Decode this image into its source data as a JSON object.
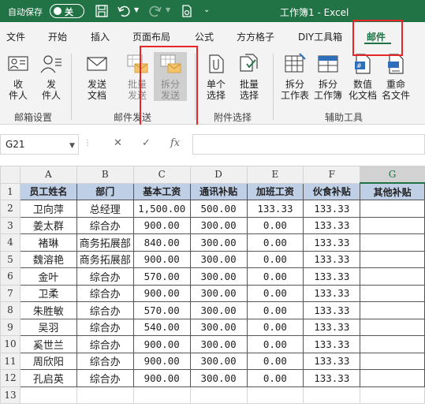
{
  "titlebar": {
    "autosave_label": "自动保存",
    "autosave_state": "关",
    "doc_title": "工作簿1  -  Excel",
    "icons": [
      "save-icon",
      "undo-icon",
      "redo-icon",
      "touch-mode-icon",
      "customize-qat-icon"
    ]
  },
  "tabs": [
    "文件",
    "开始",
    "插入",
    "页面布局",
    "公式",
    "方方格子",
    "DIY工具箱",
    "邮件"
  ],
  "active_tab": "邮件",
  "ribbon": {
    "buttons": {
      "recipient": "收\n件人",
      "sender": "发\n件人",
      "send_doc": "发送\n文档",
      "batch_send": "批量\n发送",
      "split_send": "拆分\n发送",
      "single_select": "单个\n选择",
      "batch_select": "批量\n选择",
      "split_sheet": "拆分\n工作表",
      "split_book": "拆分\n工作簿",
      "num_to_text": "数值\n化文档",
      "rename_file": "重命\n名文件"
    },
    "groups": {
      "mailbox_settings": "邮箱设置",
      "mail_send": "邮件发送",
      "attachment_select": "附件选择",
      "aux_tools": "辅助工具"
    }
  },
  "formula_bar": {
    "name_box": "G21",
    "cancel_symbol": "✕",
    "enter_symbol": "✓",
    "fx_symbol": "fx",
    "formula": ""
  },
  "sheet": {
    "columns": [
      "A",
      "B",
      "C",
      "D",
      "E",
      "F",
      "G"
    ],
    "selected_column": "G",
    "row_numbers": [
      "1",
      "2",
      "3",
      "4",
      "5",
      "6",
      "7",
      "8",
      "9",
      "10",
      "11",
      "12",
      "13"
    ],
    "headers": [
      "员工姓名",
      "部门",
      "基本工资",
      "通讯补贴",
      "加班工资",
      "伙食补贴",
      "其他补贴"
    ],
    "rows": [
      [
        "卫向萍",
        "总经理",
        "1,500.00",
        "500.00",
        "133.33",
        "133.33",
        ""
      ],
      [
        "姜太群",
        "综合办",
        "900.00",
        "300.00",
        "0.00",
        "133.33",
        ""
      ],
      [
        "褚琳",
        "商务拓展部",
        "840.00",
        "300.00",
        "0.00",
        "133.33",
        ""
      ],
      [
        "魏溶艳",
        "商务拓展部",
        "900.00",
        "300.00",
        "0.00",
        "133.33",
        ""
      ],
      [
        "金叶",
        "综合办",
        "570.00",
        "300.00",
        "0.00",
        "133.33",
        ""
      ],
      [
        "卫柔",
        "综合办",
        "900.00",
        "300.00",
        "0.00",
        "133.33",
        ""
      ],
      [
        "朱胜敏",
        "综合办",
        "570.00",
        "300.00",
        "0.00",
        "133.33",
        ""
      ],
      [
        "吴羽",
        "综合办",
        "540.00",
        "300.00",
        "0.00",
        "133.33",
        ""
      ],
      [
        "奚世兰",
        "综合办",
        "900.00",
        "300.00",
        "0.00",
        "133.33",
        ""
      ],
      [
        "周欣阳",
        "综合办",
        "900.00",
        "300.00",
        "0.00",
        "133.33",
        ""
      ],
      [
        "孔启英",
        "综合办",
        "900.00",
        "300.00",
        "0.00",
        "133.33",
        ""
      ]
    ]
  },
  "colors": {
    "excel_green": "#217346",
    "header_fill": "#bfcfe6",
    "annotation_red": "#e8262a"
  }
}
